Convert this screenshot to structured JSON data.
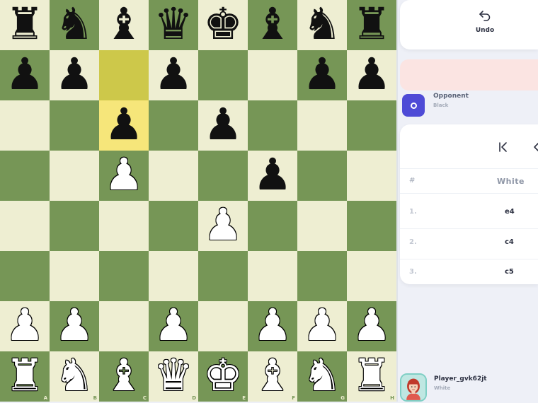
{
  "board": {
    "rows": [
      [
        "♜",
        "♞",
        "♝",
        "♛",
        "♚",
        "♝",
        "♞",
        "♜"
      ],
      [
        "♟",
        "♟",
        "",
        "♟",
        "",
        "",
        "♟",
        "♟"
      ],
      [
        "",
        "",
        "♟",
        "",
        "♟",
        "",
        "",
        ""
      ],
      [
        "",
        "",
        "♙",
        "",
        "",
        "♟",
        "",
        ""
      ],
      [
        "",
        "",
        "",
        "",
        "♙",
        "",
        "",
        ""
      ],
      [
        "",
        "",
        "",
        "",
        "",
        "",
        "",
        ""
      ],
      [
        "♙",
        "♙",
        "",
        "♙",
        "",
        "♙",
        "♙",
        "♙"
      ],
      [
        "♖",
        "♘",
        "♗",
        "♕",
        "♔",
        "♗",
        "♘",
        "♖"
      ]
    ],
    "file_labels": [
      "A",
      "B",
      "C",
      "D",
      "E",
      "F",
      "G",
      "H"
    ],
    "highlight_from": "c7",
    "highlight_to": "c6",
    "colors": {
      "light": "#eeeed2",
      "dark": "#769656",
      "highlight_from": "#cdc84a",
      "highlight_to": "#f6e67a"
    }
  },
  "toolbar": {
    "undo_label": "Undo"
  },
  "opponent": {
    "name": "Opponent",
    "color": "Black",
    "avatar_color": "#4e4bd6"
  },
  "moves": {
    "header_num": "#",
    "header_white": "White",
    "rows": [
      {
        "num": "1.",
        "white": "e4"
      },
      {
        "num": "2.",
        "white": "c4"
      },
      {
        "num": "3.",
        "white": "c5"
      }
    ]
  },
  "player": {
    "name": "Player_gvk62jt",
    "color": "White"
  },
  "accent": {
    "alert": "#fbe4e2",
    "avatar_border": "#7fcfc5"
  }
}
